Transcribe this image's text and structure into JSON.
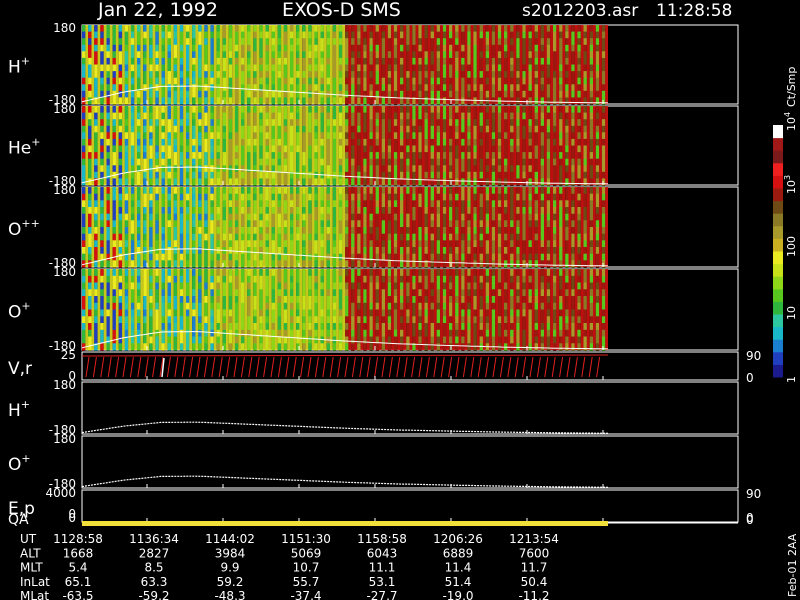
{
  "header": {
    "date": "Jan 22, 1992",
    "instrument": "EXOS-D SMS",
    "file": "s2012203.asr",
    "time": "11:28:58"
  },
  "colorbar": {
    "title": "Ct/Smp",
    "ticks": [
      {
        "label": "1",
        "value": 1
      },
      {
        "label": "10",
        "value": 10
      },
      {
        "label": "100",
        "value": 100
      },
      {
        "label": "10",
        "sup": "3",
        "value": 1000
      },
      {
        "label": "10",
        "sup": "4",
        "value": 10000
      }
    ],
    "colors": [
      "#1a1a8c",
      "#1f3fbf",
      "#1b7fd0",
      "#18b8c8",
      "#2cc6a0",
      "#2fb63c",
      "#58c81e",
      "#8fd618",
      "#c8e21a",
      "#eaea20",
      "#c9b020",
      "#a89a2a",
      "#8a7a26",
      "#6e4a14",
      "#9a1a10",
      "#d41010",
      "#f02020",
      "#7a1a1a",
      "#a01818",
      "#ffffff"
    ]
  },
  "chart_data": {
    "type": "heatmap",
    "x_ticks": [
      "1128:58",
      "1136:34",
      "1144:02",
      "1151:30",
      "1158:58",
      "1206:26",
      "1213:54"
    ],
    "panels": [
      {
        "label": "H",
        "sup": "+",
        "type": "spectrogram",
        "ylim": [
          -180,
          180
        ],
        "ytick_top": "180",
        "ytick_bottom": "-180"
      },
      {
        "label": "He",
        "sup": "+",
        "type": "spectrogram",
        "ylim": [
          -180,
          180
        ],
        "ytick_top": "180",
        "ytick_bottom": "-180"
      },
      {
        "label": "O",
        "sup": "++",
        "type": "spectrogram",
        "ylim": [
          -180,
          180
        ],
        "ytick_top": "180",
        "ytick_bottom": "-180"
      },
      {
        "label": "O",
        "sup": "+",
        "type": "spectrogram",
        "ylim": [
          -180,
          180
        ],
        "ytick_top": "180",
        "ytick_bottom": "-180"
      },
      {
        "label": "V,r",
        "sup": "",
        "type": "vectors",
        "ylim": [
          0,
          25
        ],
        "ytick_top": "25",
        "ytick_bottom": "0",
        "right_ticks": [
          "90",
          "0"
        ]
      },
      {
        "label": "H",
        "sup": "+",
        "type": "line",
        "ylim": [
          -180,
          180
        ],
        "ytick_top": "180",
        "ytick_bottom": "-180"
      },
      {
        "label": "O",
        "sup": "+",
        "type": "line",
        "ylim": [
          -180,
          180
        ],
        "ytick_top": "180",
        "ytick_bottom": "-180"
      },
      {
        "label": "E,p",
        "sup": "",
        "type": "vectors",
        "ylim": [
          0,
          4000
        ],
        "ytick_top": "4000",
        "ytick_bottom": "0",
        "right_ticks": [
          "90",
          "0"
        ]
      }
    ],
    "pitch_angle_trace": {
      "x": [
        0,
        0.08,
        0.15,
        0.22,
        0.3,
        0.4,
        0.5,
        0.6,
        0.7,
        0.8,
        0.9,
        1.0
      ],
      "y": [
        -170,
        -125,
        -100,
        -98,
        -110,
        -125,
        -140,
        -152,
        -160,
        -167,
        -172,
        -175
      ]
    },
    "qa": {
      "label": "QA",
      "ytick": "0",
      "right_tick": "0"
    }
  },
  "orbit": {
    "rows": [
      {
        "label": "UT",
        "values": [
          "1128:58",
          "1136:34",
          "1144:02",
          "1151:30",
          "1158:58",
          "1206:26",
          "1213:54"
        ]
      },
      {
        "label": "ALT",
        "values": [
          "1668",
          "2827",
          "3984",
          "5069",
          "6043",
          "6889",
          "7600"
        ]
      },
      {
        "label": "MLT",
        "values": [
          "5.4",
          "8.5",
          "9.9",
          "10.7",
          "11.1",
          "11.4",
          "11.7"
        ]
      },
      {
        "label": "InLat",
        "values": [
          "65.1",
          "63.3",
          "59.2",
          "55.7",
          "53.1",
          "51.4",
          "50.4"
        ]
      },
      {
        "label": "MLat",
        "values": [
          "-63.5",
          "-59.2",
          "-48.3",
          "-37.4",
          "-27.7",
          "-19.0",
          "-11.2"
        ]
      }
    ]
  },
  "footer": {
    "stamp": "Feb-01 2AA"
  }
}
